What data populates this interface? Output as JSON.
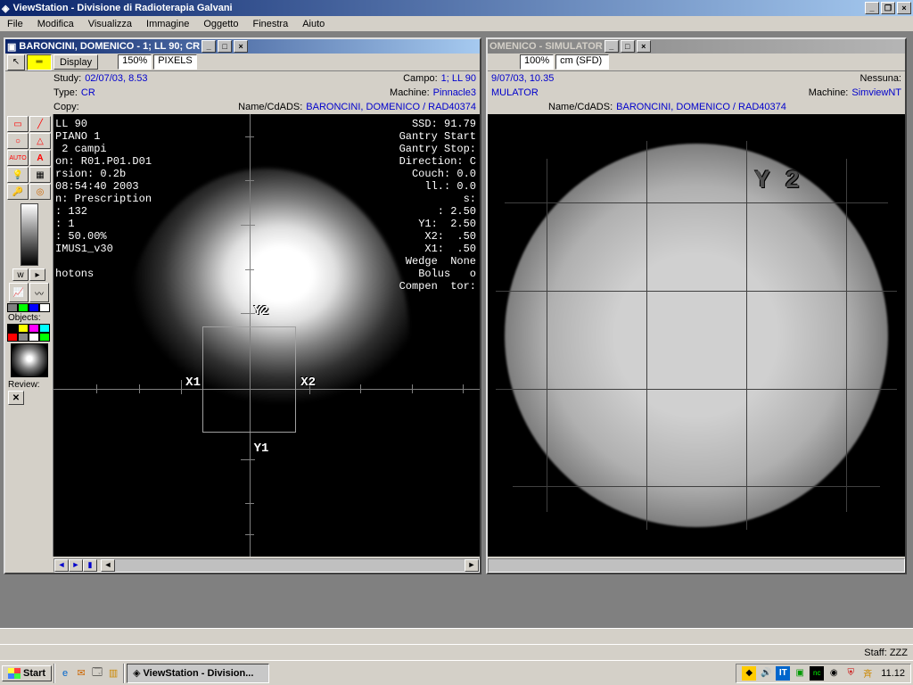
{
  "app": {
    "title": "ViewStation - Divisione di Radioterapia Galvani"
  },
  "menu": [
    "File",
    "Modifica",
    "Visualizza",
    "Immagine",
    "Oggetto",
    "Finestra",
    "Aiuto"
  ],
  "leftWindow": {
    "title": "BARONCINI, DOMENICO - 1; LL 90; CR",
    "toolbar": {
      "display": "Display",
      "zoom": "150%",
      "units": "PIXELS"
    },
    "info": {
      "studyLbl": "Study:",
      "study": "02/07/03, 8.53",
      "campoLbl": "Campo:",
      "campo": "1; LL 90",
      "typeLbl": "Type:",
      "type": "CR",
      "machineLbl": "Machine:",
      "machine": "Pinnacle3",
      "copyLbl": "Copy:",
      "nameLbl": "Name/CdADS:",
      "name": "BARONCINI, DOMENICO / RAD40374"
    },
    "sidebar": {
      "objects": "Objects:",
      "review": "Review:"
    },
    "overlayLeft": "LL 90\nPIANO 1\n 2 campi\non: R01.P01.D01\nrsion: 0.2b\n08:54:40 2003\nn: Prescription\n: 132\n: 1\n: 50.00%\nIMUS1_v30\n\nhotons",
    "overlayRight": "SSD: 91.79\nGantry Start\nGantry Stop:\nDirection: C\nCouch: 0.0\n ll.: 0.0\n  s:\n   : 2.50\nY1:  2.50\nX2:  .50\nX1:  .50\nWedge  None\nBolus   o\nCompen  tor:",
    "marks": {
      "y2": "Y2",
      "y1": "Y1",
      "x1": "X1",
      "x2": "X2"
    }
  },
  "rightWindow": {
    "title": "OMENICO - SIMULATOR",
    "toolbar": {
      "zoom": "100%",
      "units": "cm (SFD)"
    },
    "info": {
      "study": "9/07/03, 10.35",
      "nessunaLbl": "Nessuna:",
      "type": "MULATOR",
      "machineLbl": "Machine:",
      "machine": "SimviewNT",
      "nameLbl": "Name/CdADS:",
      "name": "BARONCINI, DOMENICO / RAD40374"
    },
    "marks": {
      "y2": "Y 2"
    }
  },
  "status": {
    "staff": "Staff: ZZZ"
  },
  "taskbar": {
    "start": "Start",
    "app": "ViewStation - Division...",
    "clock": "11.12"
  },
  "colors": {
    "objects": [
      "#808080",
      "#00ff00",
      "#0000ff",
      "#ffffff"
    ],
    "palette": [
      "#000000",
      "#ffff00",
      "#ff00ff",
      "#00ffff",
      "#ff0000",
      "#808080"
    ]
  }
}
